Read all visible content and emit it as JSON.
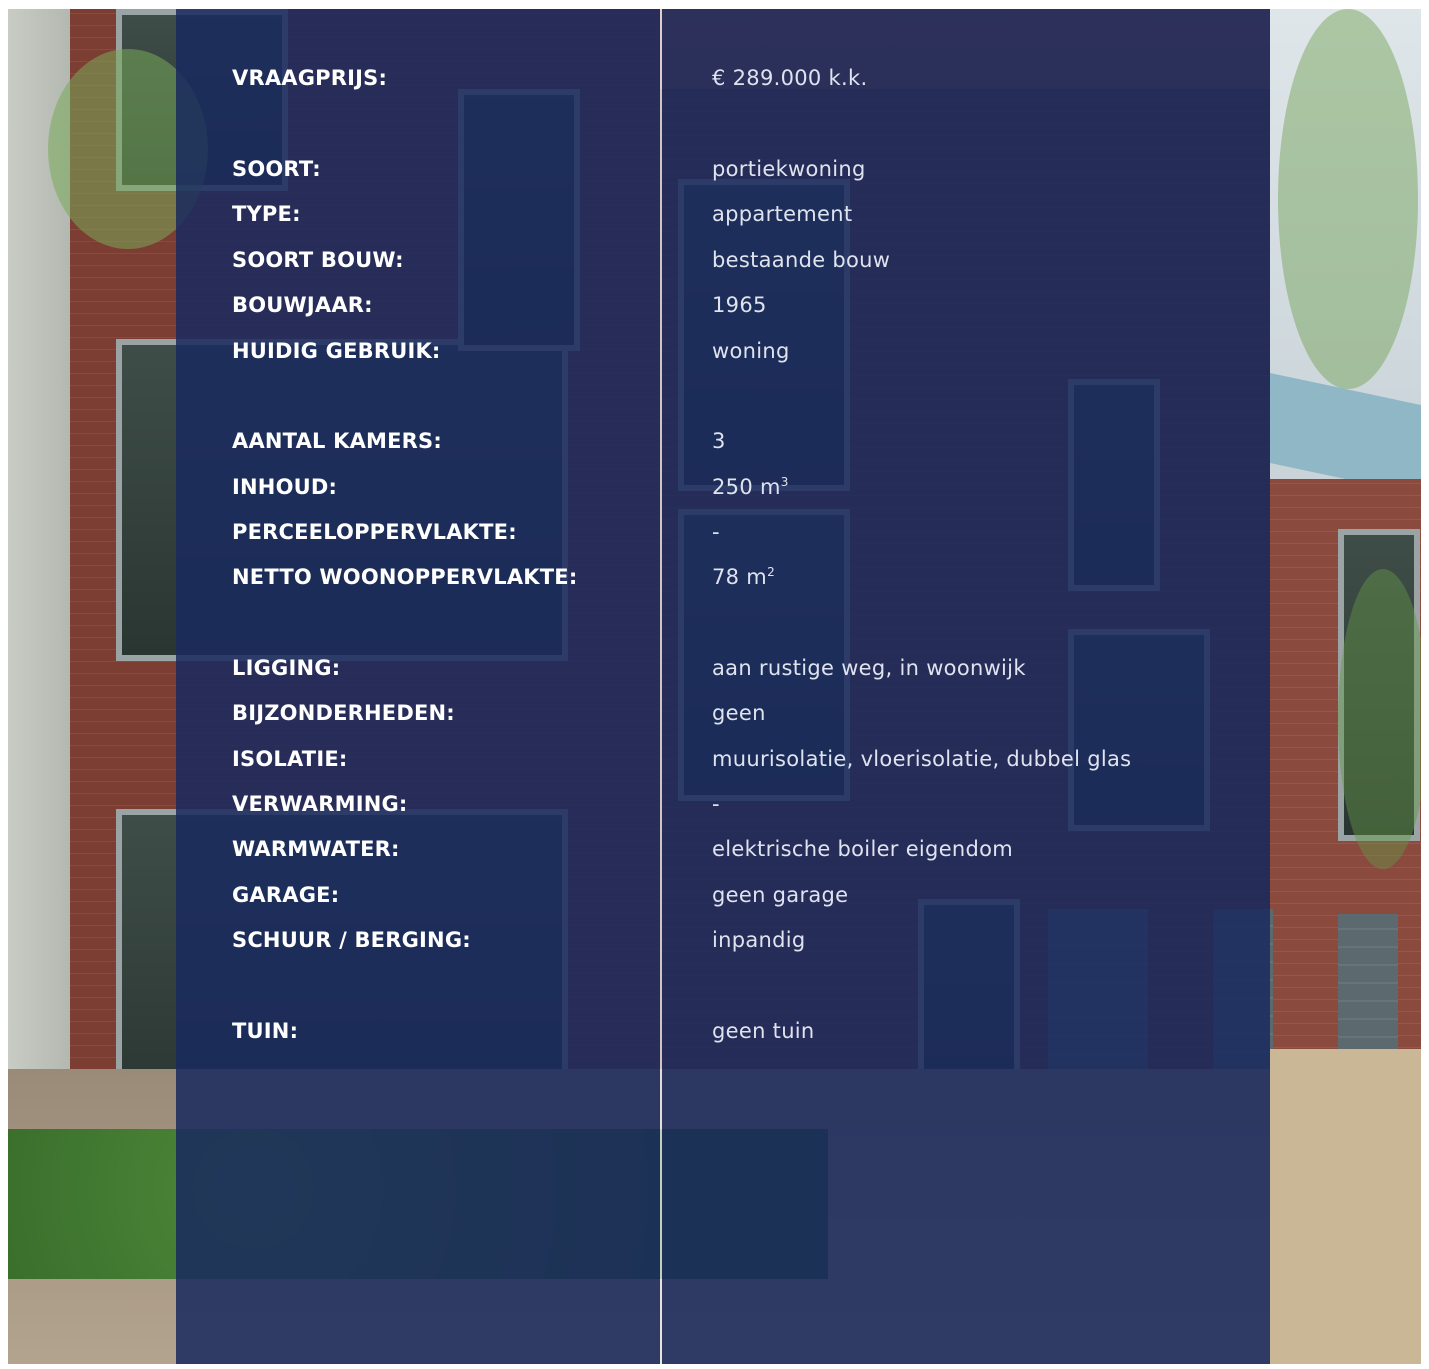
{
  "details": [
    {
      "label": "VRAAGPRIJS:",
      "value": "€ 289.000 k.k."
    },
    {
      "label": "SOORT:",
      "value": "portiekwoning"
    },
    {
      "label": "TYPE:",
      "value": "appartement"
    },
    {
      "label": "SOORT BOUW:",
      "value": "bestaande bouw"
    },
    {
      "label": "BOUWJAAR:",
      "value": "1965"
    },
    {
      "label": "HUIDIG GEBRUIK:",
      "value": "woning"
    },
    {
      "label": "AANTAL KAMERS:",
      "value": "3"
    },
    {
      "label": "INHOUD:",
      "value": "250 m",
      "unit_sup": "3"
    },
    {
      "label": "PERCEELOPPERVLAKTE:",
      "value": "-"
    },
    {
      "label": "NETTO WOONOPPERVLAKTE:",
      "value": "78 m",
      "unit_sup": "2"
    },
    {
      "label": "LIGGING:",
      "value": "aan rustige weg, in woonwijk"
    },
    {
      "label": "BIJZONDERHEDEN:",
      "value": "geen"
    },
    {
      "label": "ISOLATIE:",
      "value": "muurisolatie, vloerisolatie, dubbel glas"
    },
    {
      "label": "VERWARMING:",
      "value": "-"
    },
    {
      "label": "WARMWATER:",
      "value": "elektrische boiler eigendom"
    },
    {
      "label": "GARAGE:",
      "value": "geen garage"
    },
    {
      "label": "SCHUUR / BERGING:",
      "value": "inpandig"
    },
    {
      "label": "TUIN:",
      "value": "geen tuin"
    }
  ],
  "colors": {
    "overlay": "#1a2a5e",
    "label_text": "#ffffff",
    "value_text": "#dfe3ee"
  }
}
